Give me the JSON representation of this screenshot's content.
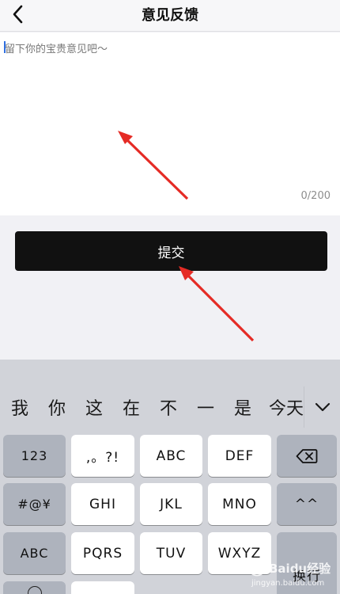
{
  "nav": {
    "title": "意见反馈",
    "back_icon": "chevron-left-icon"
  },
  "feedback": {
    "placeholder": "留下你的宝贵意见吧～",
    "char_count": "0/200"
  },
  "submit": {
    "label": "提交"
  },
  "keyboard": {
    "candidates": [
      "我",
      "你",
      "这",
      "在",
      "不",
      "一",
      "是",
      "今天"
    ],
    "expand_icon": "chevron-down-icon",
    "rows": [
      [
        "123",
        ",。?!",
        "ABC",
        "DEF"
      ],
      [
        "#@¥",
        "GHI",
        "JKL",
        "MNO"
      ],
      [
        "ABC",
        "PQRS",
        "TUV",
        "WXYZ"
      ]
    ],
    "delete_icon": "backspace-icon",
    "right_key_label": "^^",
    "return_label": "换行"
  },
  "watermark": {
    "text": "Baidu经验",
    "subtext": "jingyan.baidu.com"
  },
  "colors": {
    "submit_bg": "#111111",
    "arrow": "#e52b25",
    "keyboard_bg": "#d1d3d9",
    "func_key": "#aeb3bd"
  }
}
